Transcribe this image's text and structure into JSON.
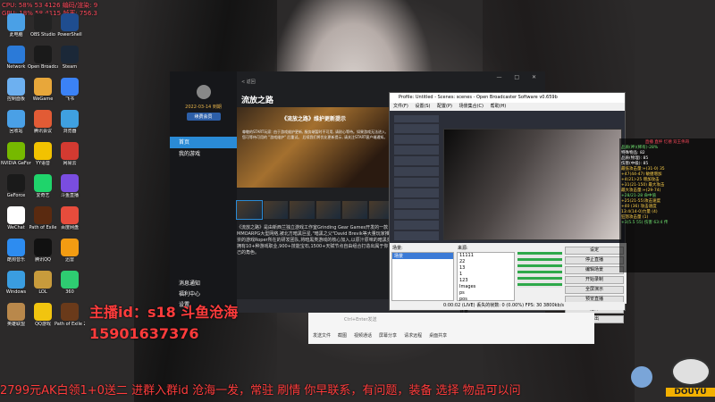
{
  "hud": {
    "line1": "CPU: 58% 53 4126",
    "line2": "GPU: 18% 58 4115",
    "line3": "UP: 2.5 174",
    "drops": "编码/渲染: 9",
    "fps": "帧率: 756.3"
  },
  "desktop_icons": [
    {
      "label": "此电脑",
      "color": "#4aa0e6"
    },
    {
      "label": "OBS Studio",
      "color": "#222"
    },
    {
      "label": "PowerShell",
      "color": "#1f4d8f"
    },
    {
      "label": "Network",
      "color": "#2b7ad8"
    },
    {
      "label": "Open Broadcaster",
      "color": "#1a1a1a"
    },
    {
      "label": "Steam",
      "color": "#1b2838"
    },
    {
      "label": "控制面板",
      "color": "#6db0f0"
    },
    {
      "label": "WeGame",
      "color": "#e8a73a"
    },
    {
      "label": "飞书",
      "color": "#3b82f6"
    },
    {
      "label": "回收站",
      "color": "#4aa0e6"
    },
    {
      "label": "腾讯会议",
      "color": "#e25b35"
    },
    {
      "label": "浏览器",
      "color": "#3fa0e0"
    },
    {
      "label": "NVIDIA GeForce Experience",
      "color": "#76b900"
    },
    {
      "label": "YY语音",
      "color": "#f2c200"
    },
    {
      "label": "网易云",
      "color": "#d33a31"
    },
    {
      "label": "GeForce",
      "color": "#1a1a1a"
    },
    {
      "label": "爱奇艺",
      "color": "#1fd46b"
    },
    {
      "label": "斗鱼直播",
      "color": "#7a4de0"
    },
    {
      "label": "WeChat",
      "color": "#fff"
    },
    {
      "label": "Path of Exile",
      "color": "#5a2a10"
    },
    {
      "label": "百度网盘",
      "color": "#e74c3c"
    },
    {
      "label": "酷狗音乐",
      "color": "#2d8cf0"
    },
    {
      "label": "腾讯QQ",
      "color": "#111"
    },
    {
      "label": "迅雷",
      "color": "#f39c12"
    },
    {
      "label": "Windows",
      "color": "#3a9de0"
    },
    {
      "label": "LOL",
      "color": "#c89b3c"
    },
    {
      "label": "360",
      "color": "#2ecc71"
    },
    {
      "label": "英雄联盟",
      "color": "#b9884b"
    },
    {
      "label": "QQ游戏",
      "color": "#f1c40f"
    },
    {
      "label": "Path of Exile 2",
      "color": "#6a3a1a"
    }
  ],
  "app": {
    "back": "< 返回",
    "title": "流放之路",
    "date": "2022-03-14 到期",
    "vip": "续费会员",
    "nav": [
      "首页",
      "我的游戏"
    ],
    "bottom_nav": [
      "消息通知",
      "福利中心",
      "设置"
    ],
    "banner_title": "《流放之路》维护更新提示",
    "banner_body": "尊敬的START玩家: 由于游戏维护更新, 服务端暂时不可用, 请耐心等待。如果游戏无法进入, 您可等待可用的 \"游戏维护\" 后重试。 后续我们将优化更新提示, 请关注START客户端通知。",
    "desc": "《流放之路》是由新西兰独立游戏工作室Grinding Gear Games开发的一款MMOARPG大型网络,被北方暗黑巨星,\"暗黑之父\"David Brevik等大量玩家推崇的游戏Roper所在的研发团队,将暗黑类游戏的核心加入,以原汁原味的暗黑类,拥有10+种游戏职业,900+技能宝石,1500+天赋节点自由组合打造出属于你自己的角色。"
  },
  "obs": {
    "title": "Profile: Untitled - Scenes: scenes - Open Broadcaster Software v0.659b",
    "menu": [
      "文件(F)",
      "设置(S)",
      "配置(P)",
      "场景集合(C)",
      "帮助(H)"
    ],
    "scenes_label": "场景:",
    "scene_item": "场景",
    "sources_label": "来源:",
    "sources": [
      "11111",
      "22",
      "13",
      "1",
      "123",
      "Images",
      "ps",
      "pos",
      "主屏",
      "背景"
    ],
    "buttons": [
      "设定",
      "停止直播",
      "编辑场景",
      "开始录制",
      "全屏演示",
      "预览直播",
      "插件",
      "退出"
    ],
    "status": "0:00:02 (LIVE)   丢失的帧数: 0 (0.00%)   FPS: 30   3800kb/s"
  },
  "chat": {
    "title": "直播 直抨 忆德 双王伟哥",
    "lines": [
      {
        "c": "g",
        "t": "品质(神)(稀有)-28%"
      },
      {
        "c": "w",
        "t": "特殊物品: 82"
      },
      {
        "c": "w",
        "t": "品质(物理): 85"
      },
      {
        "c": "w",
        "t": "伤害(中级): 85"
      },
      {
        "c": "y",
        "t": "最低攻击量:+(31-0) 35"
      },
      {
        "c": "y",
        "t": "+47(44-47) 敏捷增加"
      },
      {
        "c": "y",
        "t": "+4(21)-25 增加攻击"
      },
      {
        "c": "y",
        "t": "+31(21-150) 最大攻击"
      },
      {
        "c": "y",
        "t": "最大攻击量:+(29-74)"
      },
      {
        "c": "g",
        "t": "+28/21-28 命中值"
      },
      {
        "c": "y",
        "t": "+25(21-55)攻击速度"
      },
      {
        "c": "y",
        "t": "+40 (36) 攻击速度"
      },
      {
        "c": "y",
        "t": "13:4(14-0)力量 (4)"
      },
      {
        "c": "y",
        "t": "狂怒攻击量 (1)"
      },
      {
        "c": "g",
        "t": "+3(5.5 55) 伤害 63:4 传"
      }
    ]
  },
  "qq": {
    "placeholder": "Ctrl+Enter发送",
    "toolbar": [
      "发送文件",
      "截图",
      "视频通话",
      "屏幕分享",
      "请求远程",
      "桌面共享"
    ]
  },
  "overlay": {
    "streamer": "主播id：s18 斗鱼沧海",
    "phone": "15901637376",
    "scroller": "2799元AK白领1+0送二 进群入群id 沧海一发，常驻 刷情 你早联系，有问题，装备 选择 物品可以问"
  },
  "brand": "DOUYU"
}
